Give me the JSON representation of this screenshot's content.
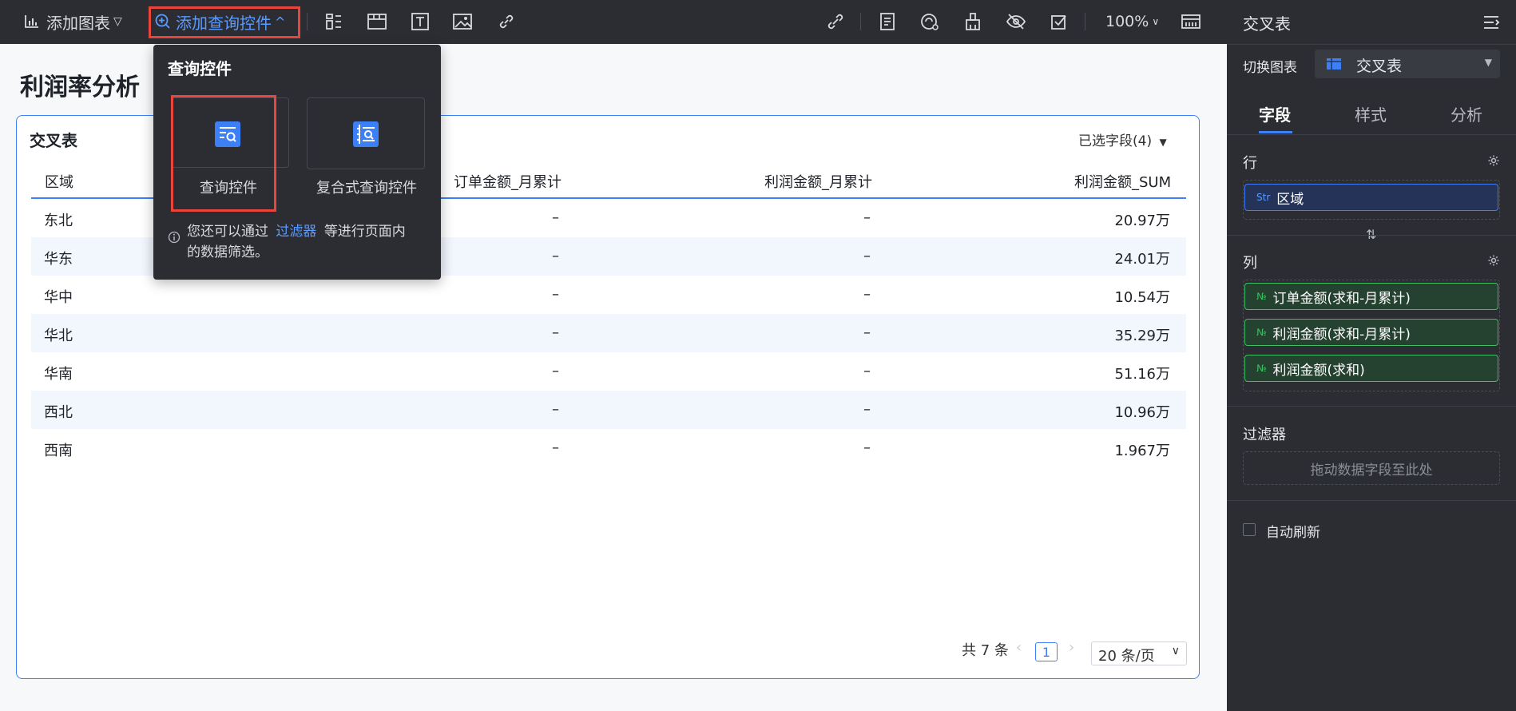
{
  "toolbar": {
    "add_chart": "添加图表",
    "add_query_control": "添加查询控件",
    "zoom": "100%"
  },
  "page": {
    "title": "利润率分析"
  },
  "popup": {
    "title": "查询控件",
    "tiles": [
      "查询控件",
      "复合式查询控件"
    ],
    "hint_prefix": "您还可以通过",
    "hint_link": "过滤器",
    "hint_suffix": "等进行页面内",
    "hint_line2": "的数据筛选。"
  },
  "card": {
    "title": "交叉表",
    "selected_fields": "已选字段(4)",
    "columns": [
      "区域",
      "订单金额_月累计",
      "利润金额_月累计",
      "利润金额_SUM"
    ],
    "rows": [
      {
        "region": "东北",
        "order": "–",
        "profit_month": "–",
        "profit_sum": "20.97万"
      },
      {
        "region": "华东",
        "order": "–",
        "profit_month": "–",
        "profit_sum": "24.01万"
      },
      {
        "region": "华中",
        "order": "–",
        "profit_month": "–",
        "profit_sum": "10.54万"
      },
      {
        "region": "华北",
        "order": "–",
        "profit_month": "–",
        "profit_sum": "35.29万"
      },
      {
        "region": "华南",
        "order": "–",
        "profit_month": "–",
        "profit_sum": "51.16万"
      },
      {
        "region": "西北",
        "order": "–",
        "profit_month": "–",
        "profit_sum": "10.96万"
      },
      {
        "region": "西南",
        "order": "–",
        "profit_month": "–",
        "profit_sum": "1.967万"
      }
    ],
    "pager": {
      "total": "共 7 条",
      "page": "1",
      "page_size": "20 条/页"
    }
  },
  "sidebar": {
    "title": "交叉表",
    "switch_chart_label": "切换图表",
    "switch_chart_value": "交叉表",
    "tabs": [
      "字段",
      "样式",
      "分析"
    ],
    "row_label": "行",
    "row_fields": [
      {
        "tag": "Str",
        "name": "区域"
      }
    ],
    "col_label": "列",
    "col_fields": [
      {
        "tag": "№",
        "name": "订单金额(求和-月累计)"
      },
      {
        "tag": "№",
        "name": "利润金额(求和-月累计)"
      },
      {
        "tag": "№",
        "name": "利润金额(求和)"
      }
    ],
    "filter_label": "过滤器",
    "filter_placeholder": "拖动数据字段至此处",
    "auto_refresh": "自动刷新"
  },
  "colors": {
    "accent": "#3d7ff5",
    "highlight": "#e8453c",
    "dark_bg": "#2b2d33"
  }
}
